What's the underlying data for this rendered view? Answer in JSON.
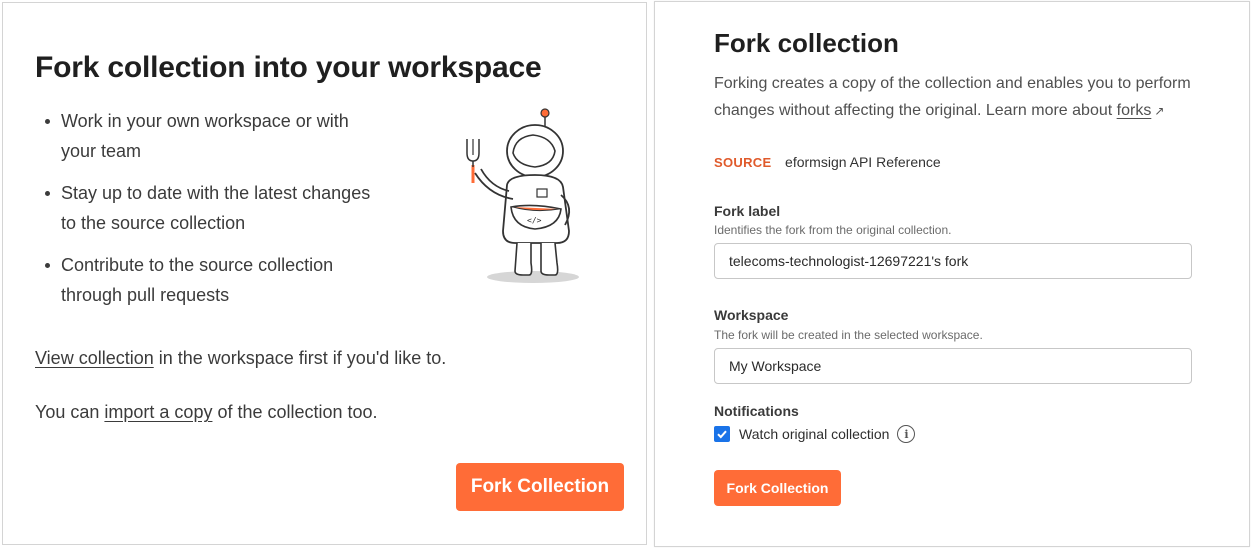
{
  "left": {
    "title": "Fork collection into your workspace",
    "bullets": [
      "Work in your own workspace or with your team",
      "Stay up to date with the latest changes to the source collection",
      "Contribute to the source collection through pull requests"
    ],
    "view_link": "View collection",
    "view_rest": " in the workspace first if you'd like to.",
    "import_prefix": "You can ",
    "import_link": "import a copy",
    "import_rest": " of the collection too.",
    "fork_button": "Fork Collection"
  },
  "right": {
    "title": "Fork collection",
    "description": "Forking creates a copy of the collection and enables you to perform changes without affecting the original. Learn more about ",
    "forks_link": "forks",
    "external_icon": "↗",
    "source_key": "SOURCE",
    "source_value": "eformsign API Reference",
    "fork_label_title": "Fork label",
    "fork_label_help": "Identifies the fork from the original collection.",
    "fork_label_value": "telecoms-technologist-12697221's fork",
    "workspace_title": "Workspace",
    "workspace_help": "The fork will be created in the selected workspace.",
    "workspace_value": "My Workspace",
    "notifications_title": "Notifications",
    "watch_label": "Watch original collection",
    "watch_checked": true,
    "info_icon_glyph": "i",
    "fork_button": "Fork Collection"
  },
  "colors": {
    "accent": "#ff6c37",
    "source_key": "#e05a2b",
    "checkbox": "#1a73e8"
  },
  "icons": [
    "astronaut-illustration",
    "external-link-icon",
    "check-icon",
    "info-icon"
  ]
}
